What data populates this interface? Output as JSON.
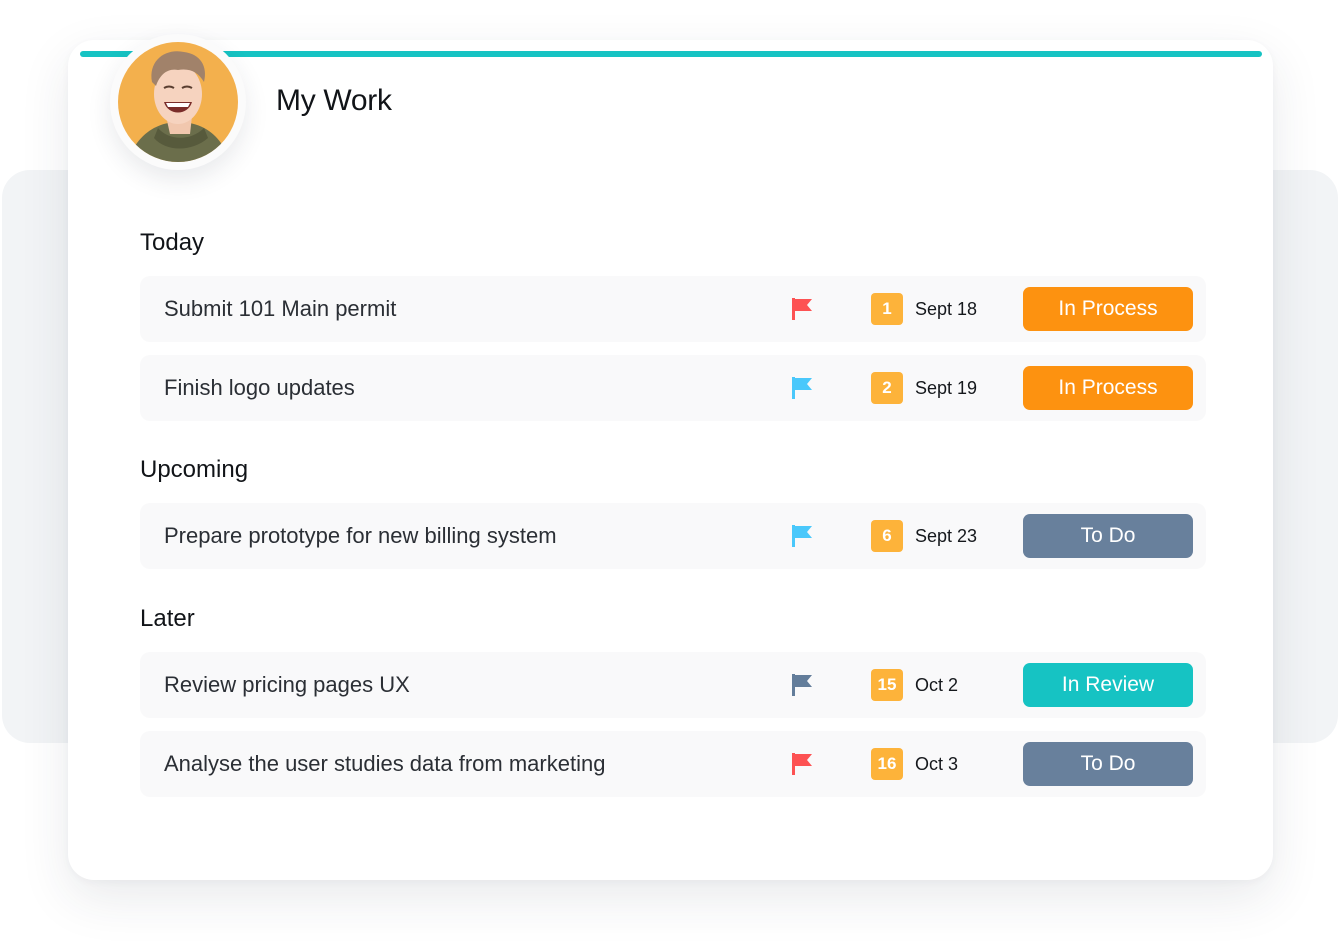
{
  "page": {
    "title": "My Work",
    "accent_color": "#16c3c3"
  },
  "avatar": {
    "alt": "user-avatar",
    "bg_color": "#f3b04d"
  },
  "sections": [
    {
      "label": "Today",
      "tasks": [
        {
          "name": "Submit 101 Main permit",
          "flag": "red",
          "number": "1",
          "date": "Sept 18",
          "status": "In Process"
        },
        {
          "name": "Finish logo updates",
          "flag": "blue",
          "number": "2",
          "date": "Sept 19",
          "status": "In Process"
        }
      ]
    },
    {
      "label": "Upcoming",
      "tasks": [
        {
          "name": "Prepare prototype for new billing system",
          "flag": "blue",
          "number": "6",
          "date": "Sept 23",
          "status": "To Do"
        }
      ]
    },
    {
      "label": "Later",
      "tasks": [
        {
          "name": "Review pricing pages UX",
          "flag": "gray",
          "number": "15",
          "date": "Oct 2",
          "status": "In Review"
        },
        {
          "name": "Analyse the user studies data from marketing",
          "flag": "red",
          "number": "16",
          "date": "Oct 3",
          "status": "To Do"
        }
      ]
    }
  ],
  "colors": {
    "flag": {
      "red": "#fd5253",
      "blue": "#4ac8fb",
      "gray": "#637d9a"
    },
    "status": {
      "In Process": "#fd9210",
      "To Do": "#68809c",
      "In Review": "#16c3c3"
    },
    "number_badge": "#fdb33a"
  }
}
